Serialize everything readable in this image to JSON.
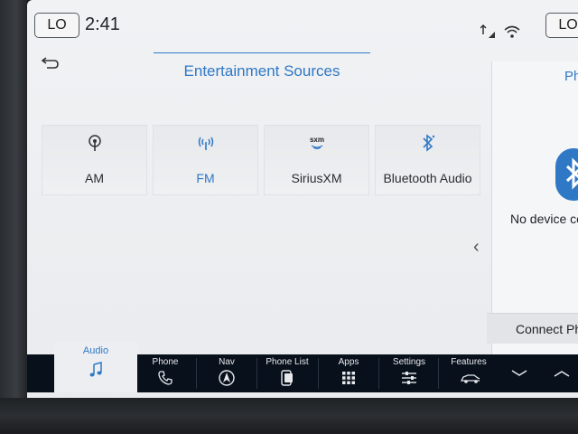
{
  "status": {
    "left_badge": "LO",
    "time": "2:41",
    "right_badge": "LO"
  },
  "panel": {
    "title": "Entertainment Sources",
    "sources": [
      {
        "label": "AM",
        "icon": "antenna-icon",
        "active": false
      },
      {
        "label": "FM",
        "icon": "radio-signal-icon",
        "active": true
      },
      {
        "label": "SiriusXM",
        "icon": "sxm-icon",
        "active": false
      },
      {
        "label": "Bluetooth Audio",
        "icon": "bluetooth-icon",
        "active": false
      }
    ]
  },
  "right_panel": {
    "title": "Ph",
    "message": "No device co",
    "connect_label": "Connect Ph"
  },
  "bottom_bar": {
    "audio_label": "Audio",
    "items": [
      {
        "label": "Phone",
        "icon": "phone-icon"
      },
      {
        "label": "Nav",
        "icon": "navigation-icon"
      },
      {
        "label": "Phone List",
        "icon": "phone-list-icon"
      },
      {
        "label": "Apps",
        "icon": "apps-grid-icon"
      },
      {
        "label": "Settings",
        "icon": "settings-sliders-icon"
      },
      {
        "label": "Features",
        "icon": "car-icon"
      }
    ]
  },
  "colors": {
    "accent": "#2f78c6",
    "bar": "#08101c",
    "screen": "#eceef1"
  }
}
